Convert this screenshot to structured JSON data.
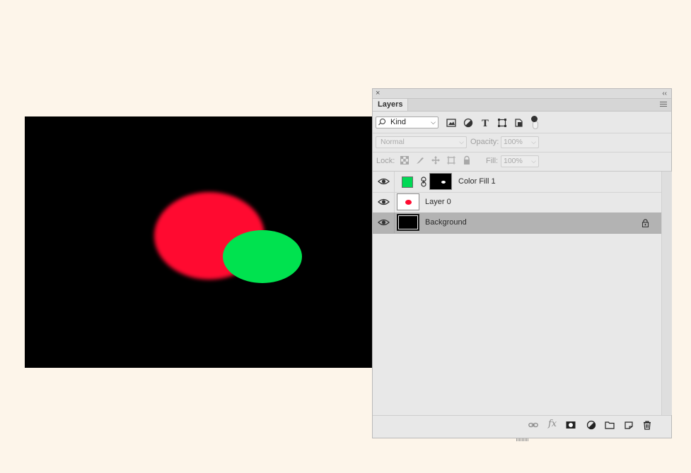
{
  "document": {
    "canvas_background": "#000000",
    "shapes": [
      {
        "name": "red-blob",
        "color": "#ff0a30",
        "blurred": true
      },
      {
        "name": "green-ellipse",
        "color": "#00e24f",
        "blurred": false
      }
    ]
  },
  "panel": {
    "close_glyph": "×",
    "collapse_glyph": "‹‹",
    "tab_label": "Layers",
    "filter": {
      "kind_label": "Kind",
      "filter_icons": [
        "pixel-layer-filter-icon",
        "adjustment-layer-filter-icon",
        "type-layer-filter-icon",
        "shape-layer-filter-icon",
        "smart-object-filter-icon"
      ],
      "type_glyph": "T"
    },
    "blend": {
      "mode": "Normal",
      "opacity_label": "Opacity:",
      "opacity_value": "100%"
    },
    "lock": {
      "label": "Lock:",
      "fill_label": "Fill:",
      "fill_value": "100%"
    },
    "layers": [
      {
        "name": "Color Fill 1",
        "visible": true,
        "thumb_color": "#00d955",
        "has_mask": true,
        "locked": false,
        "selected": false
      },
      {
        "name": "Layer 0",
        "visible": true,
        "thumb_color": "#ff0a30",
        "has_mask": false,
        "locked": false,
        "selected": false
      },
      {
        "name": "Background",
        "visible": true,
        "thumb_color": "#000000",
        "has_mask": false,
        "locked": true,
        "selected": true
      }
    ],
    "bottom_icons": [
      "link-layers-icon",
      "fx-icon",
      "add-mask-icon",
      "adjustment-layer-icon",
      "new-group-icon",
      "new-layer-icon",
      "delete-layer-icon"
    ],
    "fx_label": "fx"
  }
}
